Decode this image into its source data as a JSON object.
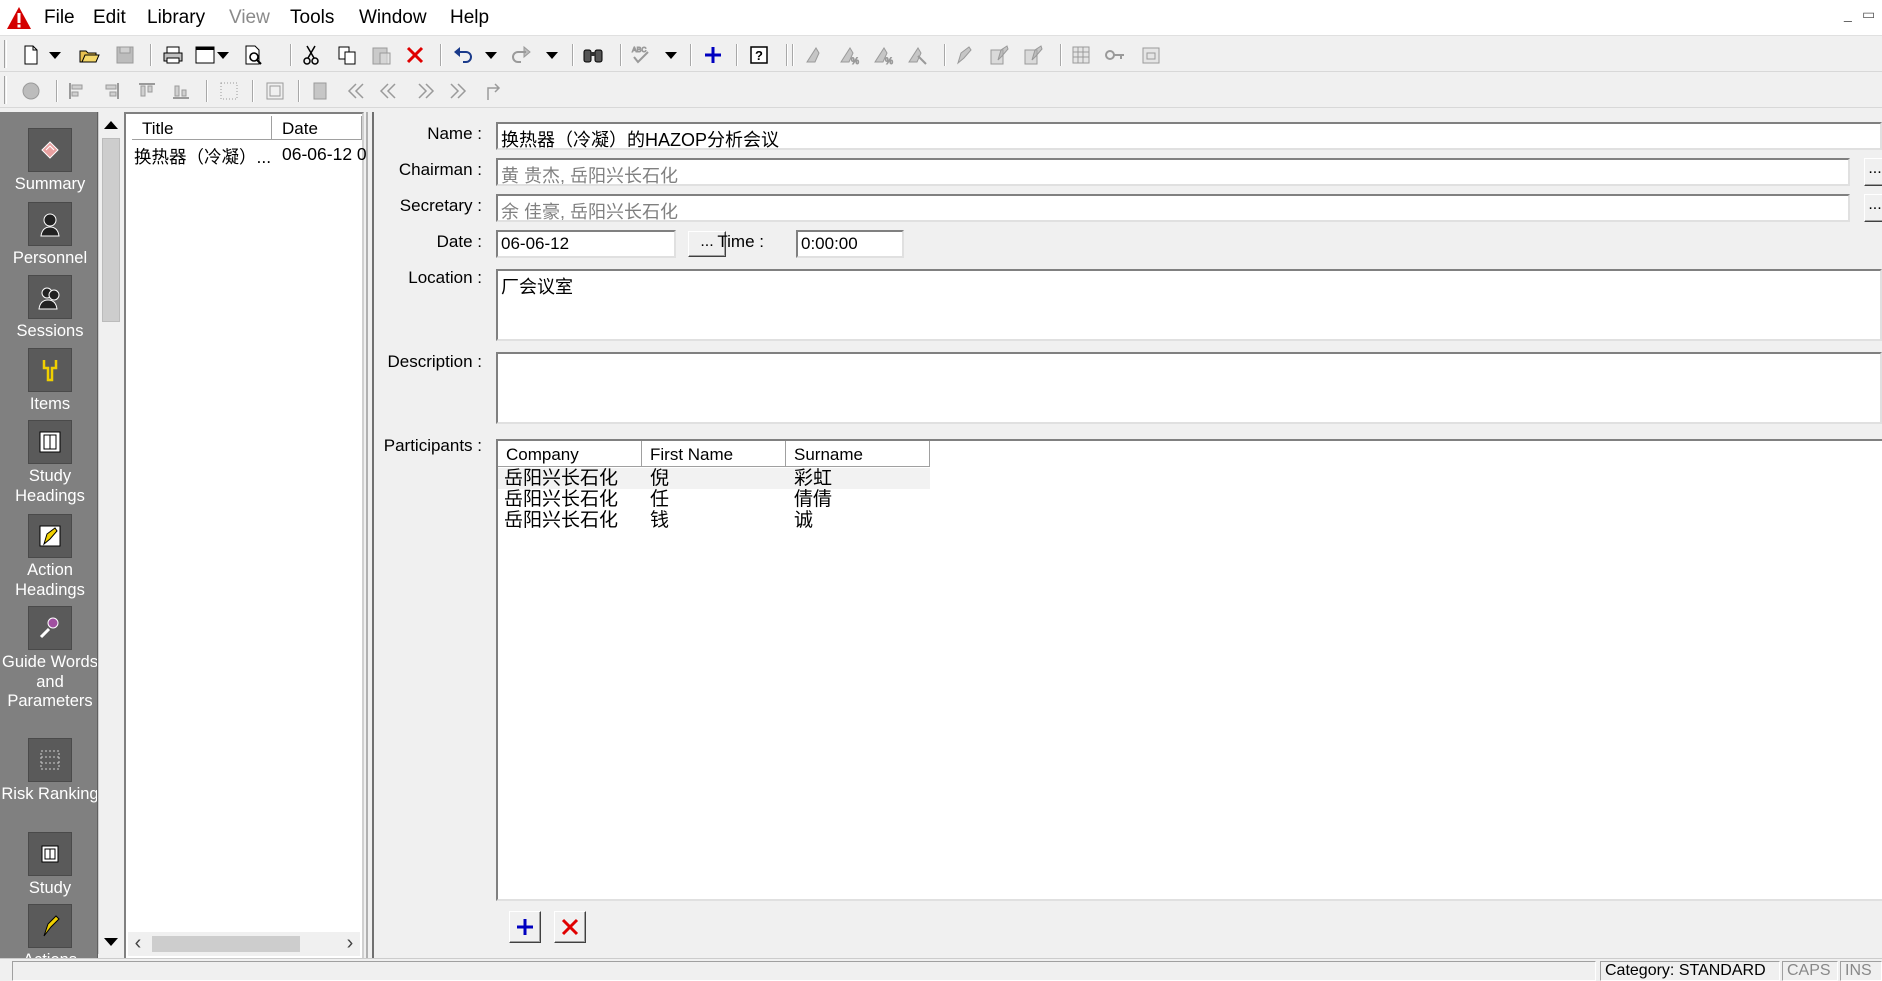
{
  "menu": {
    "items": [
      "File",
      "Edit",
      "Library",
      "View",
      "Tools",
      "Window",
      "Help"
    ]
  },
  "toolbar1": {
    "icons": [
      "new-document-icon",
      "open-folder-icon",
      "save-icon",
      "print-icon",
      "page-setup-icon",
      "print-preview-icon",
      "cut-icon",
      "copy-icon",
      "paste-icon",
      "delete-icon",
      "undo-icon",
      "redo-icon",
      "find-icon",
      "spell-check-icon",
      "add-icon",
      "help-icon"
    ]
  },
  "outlook_bar": {
    "items": [
      {
        "label": "Summary",
        "icon": "summary-icon"
      },
      {
        "label": "Personnel",
        "icon": "personnel-icon"
      },
      {
        "label": "Sessions",
        "icon": "sessions-icon"
      },
      {
        "label": "Items",
        "icon": "items-icon"
      },
      {
        "label": "Study Headings",
        "icon": "study-headings-icon"
      },
      {
        "label": "Action Headings",
        "icon": "action-headings-icon"
      },
      {
        "label": "Guide Words and Parameters",
        "icon": "guide-words-icon"
      },
      {
        "label": "Risk Ranking",
        "icon": "risk-ranking-icon"
      },
      {
        "label": "Study",
        "icon": "study-icon"
      },
      {
        "label": "Actions",
        "icon": "actions-icon"
      }
    ]
  },
  "list": {
    "columns": [
      "Title",
      "Date"
    ],
    "rows": [
      {
        "title": "换热器（冷凝）...",
        "date": "06-06-12 0"
      }
    ]
  },
  "form": {
    "name_label": "Name :",
    "name_value": "换热器（冷凝）的HAZOP分析会议",
    "chairman_label": "Chairman :",
    "chairman_value": "黄 贵杰, 岳阳兴长石化",
    "secretary_label": "Secretary :",
    "secretary_value": "余 佳豪, 岳阳兴长石化",
    "date_label": "Date :",
    "date_value": "06-06-12",
    "date_button": "...",
    "time_label": "Time :",
    "time_value": "0:00:00",
    "location_label": "Location :",
    "location_value": "厂会议室",
    "description_label": "Description :",
    "description_value": "",
    "participants_label": "Participants :",
    "lookup_button": "...",
    "participants": {
      "columns": [
        "Company",
        "First Name",
        "Surname"
      ],
      "rows": [
        {
          "company": "岳阳兴长石化",
          "first": "倪",
          "surname": "彩虹"
        },
        {
          "company": "岳阳兴长石化",
          "first": "任",
          "surname": "倩倩"
        },
        {
          "company": "岳阳兴长石化",
          "first": "钱",
          "surname": "诚"
        }
      ]
    }
  },
  "status": {
    "category": "Category: STANDARD",
    "caps": "CAPS",
    "ins": "INS"
  },
  "colors": {
    "outlook_bg": "#808080",
    "delete_red": "#e00000",
    "add_blue": "#0000c0"
  }
}
